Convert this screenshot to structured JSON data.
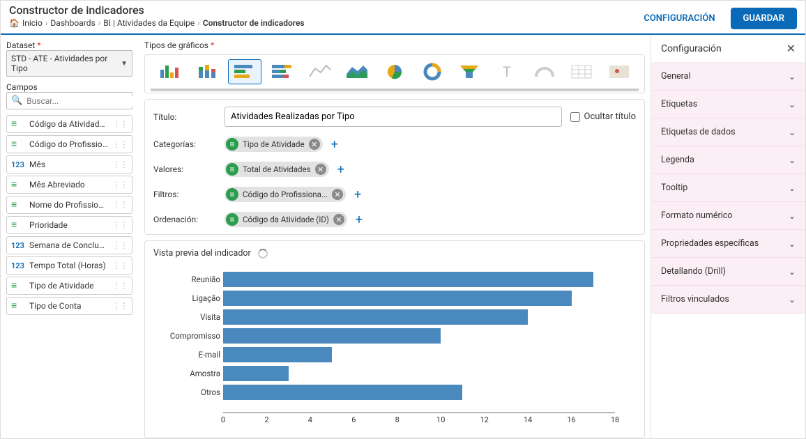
{
  "header": {
    "title": "Constructor de indicadores",
    "breadcrumbs": [
      "Inicio",
      "Dashboards",
      "BI | Atividades da Equipe",
      "Constructor de indicadores"
    ],
    "config_label": "CONFIGURACIÓN",
    "save_label": "GUARDAR"
  },
  "left": {
    "dataset_label": "Dataset",
    "dataset_value": "STD - ATE - Atividades por Tipo",
    "fields_label": "Campos",
    "search_placeholder": "Buscar...",
    "fields": [
      {
        "type": "text",
        "name": "Código da Atividade (ID)"
      },
      {
        "type": "text",
        "name": "Código do Profissional (..."
      },
      {
        "type": "num",
        "name": "Mês"
      },
      {
        "type": "text",
        "name": "Mês Abreviado"
      },
      {
        "type": "text",
        "name": "Nome do Profissional"
      },
      {
        "type": "text",
        "name": "Prioridade"
      },
      {
        "type": "num",
        "name": "Semana de Conclusão"
      },
      {
        "type": "num",
        "name": "Tempo Total (Horas)"
      },
      {
        "type": "text",
        "name": "Tipo de Atividade"
      },
      {
        "type": "text",
        "name": "Tipo de Conta"
      }
    ]
  },
  "center": {
    "chart_types_label": "Tipos de gráficos",
    "title_label": "Título:",
    "title_value": "Atividades Realizadas por Tipo",
    "hide_title_label": "Ocultar título",
    "categories_label": "Categorías:",
    "values_label": "Valores:",
    "filters_label": "Filtros:",
    "ordering_label": "Ordenación:",
    "chip_category": "Tipo de Atividade",
    "chip_value": "Total de Atividades",
    "chip_filter": "Código do Profissiona...",
    "chip_order": "Código da Atividade (ID)",
    "preview_label": "Vista previa del indicador"
  },
  "right": {
    "title": "Configuración",
    "sections": [
      "General",
      "Etiquetas",
      "Etiquetas de dados",
      "Legenda",
      "Tooltip",
      "Formato numérico",
      "Propriedades específicas",
      "Detallando (Drill)",
      "Filtros vinculados"
    ]
  },
  "chart_data": {
    "type": "bar",
    "orientation": "horizontal",
    "title": "Atividades Realizadas por Tipo",
    "xlabel": "",
    "ylabel": "",
    "xlim": [
      0,
      18
    ],
    "xticks": [
      0,
      2,
      4,
      6,
      8,
      10,
      12,
      14,
      16,
      18
    ],
    "categories": [
      "Reunião",
      "Ligação",
      "Visita",
      "Compromisso",
      "E-mail",
      "Amostra",
      "Otros"
    ],
    "values": [
      17,
      16,
      14,
      10,
      5,
      3,
      11
    ]
  }
}
